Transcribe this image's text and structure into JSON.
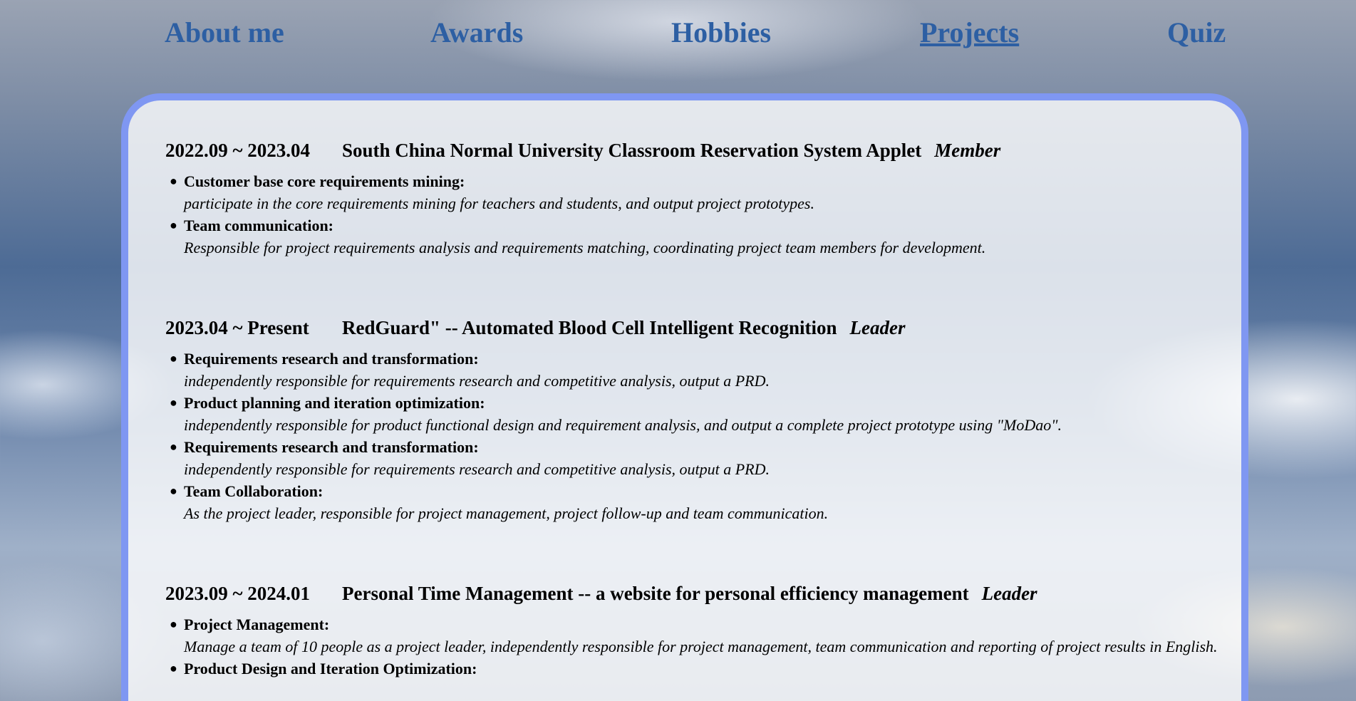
{
  "nav": {
    "items": [
      {
        "label": "About me",
        "active": false
      },
      {
        "label": "Awards",
        "active": false
      },
      {
        "label": "Hobbies",
        "active": false
      },
      {
        "label": "Projects",
        "active": true
      },
      {
        "label": "Quiz",
        "active": false
      }
    ]
  },
  "colors": {
    "nav_link": "#2d5fa3",
    "card_border": "#7f97f2",
    "card_background": "rgba(255,255,255,0.80)"
  },
  "projects": [
    {
      "date": "2022.09 ~ 2023.04",
      "title": "South China Normal University Classroom Reservation System Applet",
      "role": "Member",
      "bullets": [
        {
          "title": "Customer base core requirements mining:",
          "desc": "participate in the core requirements mining for teachers and students, and output project prototypes."
        },
        {
          "title": "Team communication:",
          "desc": "Responsible for project requirements analysis and requirements matching, coordinating project team members for development."
        }
      ]
    },
    {
      "date": "2023.04 ~ Present",
      "title": "RedGuard\" -- Automated Blood Cell Intelligent Recognition",
      "role": "Leader",
      "bullets": [
        {
          "title": "Requirements research and transformation:",
          "desc": "independently responsible for requirements research and competitive analysis, output a PRD."
        },
        {
          "title": "Product planning and iteration optimization:",
          "desc": "independently responsible for product functional design and requirement analysis, and output a complete project prototype using \"MoDao\"."
        },
        {
          "title": "Requirements research and transformation:",
          "desc": "independently responsible for requirements research and competitive analysis, output a PRD."
        },
        {
          "title": "Team Collaboration:",
          "desc": "As the project leader, responsible for project management, project follow-up and team communication."
        }
      ]
    },
    {
      "date": "2023.09 ~ 2024.01",
      "title": "Personal Time Management -- a website for personal efficiency management",
      "role": "Leader",
      "bullets": [
        {
          "title": "Project Management:",
          "desc": "Manage a team of 10 people as a project leader, independently responsible for project management, team communication and reporting of project results in English."
        },
        {
          "title": "Product Design and Iteration Optimization:",
          "desc": ""
        }
      ]
    }
  ]
}
